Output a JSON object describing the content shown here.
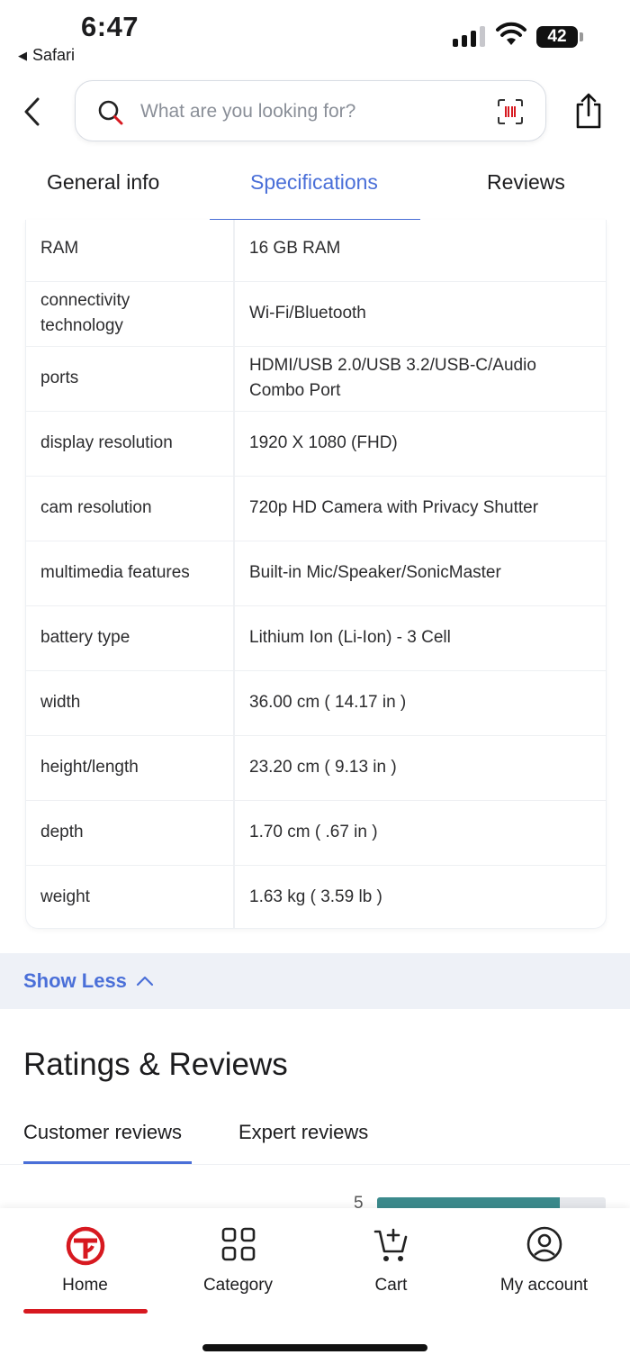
{
  "status_bar": {
    "time": "6:47",
    "back_app": "Safari",
    "battery": "42"
  },
  "header": {
    "search_placeholder": "What are you looking for?"
  },
  "tabs": [
    {
      "label": "General info",
      "active": false
    },
    {
      "label": "Specifications",
      "active": true
    },
    {
      "label": "Reviews",
      "active": false
    }
  ],
  "specs": [
    {
      "key": "RAM",
      "value": "16 GB RAM"
    },
    {
      "key": "connectivity technology",
      "value": "Wi-Fi/Bluetooth"
    },
    {
      "key": "ports",
      "value": "HDMI/USB 2.0/USB 3.2/USB-C/Audio Combo Port"
    },
    {
      "key": "display resolution",
      "value": "1920 X 1080 (FHD)"
    },
    {
      "key": "cam resolution",
      "value": "720p HD Camera with Privacy Shutter"
    },
    {
      "key": "multimedia features",
      "value": "Built-in Mic/Speaker/SonicMaster"
    },
    {
      "key": "battery type",
      "value": "Lithium Ion (Li-Ion) - 3 Cell"
    },
    {
      "key": "width",
      "value": "36.00 cm ( 14.17 in )"
    },
    {
      "key": "height/length",
      "value": "23.20 cm ( 9.13 in )"
    },
    {
      "key": "depth",
      "value": "1.70 cm ( .67 in )"
    },
    {
      "key": "weight",
      "value": "1.63 kg ( 3.59 lb )"
    }
  ],
  "show_less_label": "Show Less",
  "ratings": {
    "title": "Ratings & Reviews",
    "tabs": [
      {
        "label": "Customer reviews",
        "active": true
      },
      {
        "label": "Expert reviews",
        "active": false
      }
    ],
    "star_row": {
      "label": "5",
      "fill_fraction": 0.8
    }
  },
  "bottom_nav": [
    {
      "label": "Home",
      "icon": "home-logo-icon",
      "active": true
    },
    {
      "label": "Category",
      "icon": "grid-icon",
      "active": false
    },
    {
      "label": "Cart",
      "icon": "cart-add-icon",
      "active": false
    },
    {
      "label": "My account",
      "icon": "user-icon",
      "active": false
    }
  ],
  "colors": {
    "accent": "#4a6fd8",
    "brand_red": "#d71920",
    "rating_bar": "#3b8a8c"
  }
}
